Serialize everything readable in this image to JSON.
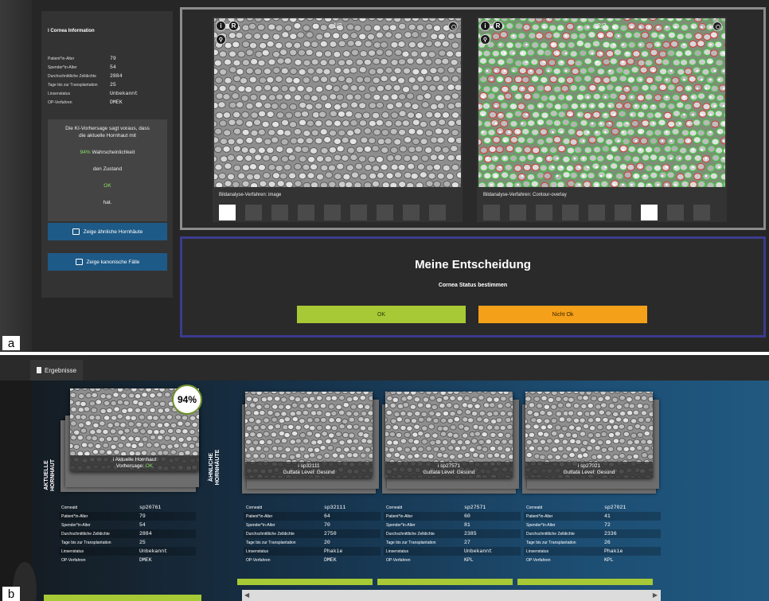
{
  "panel_a": {
    "letter": "a",
    "info_title": "i Cornea Information",
    "info_rows": [
      {
        "label": "Patient*in-Alter",
        "value": "79"
      },
      {
        "label": "Spender*in-Alter",
        "value": "54"
      },
      {
        "label": "Durchschnittliche Zelldichte",
        "value": "2884"
      },
      {
        "label": "Tage bis zur Transplantation",
        "value": "25"
      },
      {
        "label": "Linsenstatus",
        "value": "Unbekannt"
      },
      {
        "label": "OP-Verfahren",
        "value": "DMEK"
      }
    ],
    "prediction": {
      "line1": "Die KI-Vorhersage sagt voraus, dass",
      "line2": "die aktuelle Hornhaut mit",
      "percent": "94%",
      "line3": "Wahrscheinlichkeit",
      "line4": "den Zustand",
      "state": "OK",
      "line5": "hat."
    },
    "buttons": {
      "similar": "Zeige ähnliche Hornhäute",
      "canonical": "Zeige kanonische Fälle"
    },
    "viewers": [
      {
        "page": "1/2",
        "method_label": "Bildanalyse-Verfahren: image",
        "info": "i",
        "reset": "R",
        "active_thumb": 0,
        "thumb_count": 9
      },
      {
        "page": "2/2",
        "method_label": "Bildanalyse-Verfahren: Contour-overlay",
        "info": "i",
        "reset": "R",
        "active_thumb": 6,
        "thumb_count": 9
      }
    ],
    "decision": {
      "title": "Meine Entscheidung",
      "subtitle": "Cornea Status bestimmen",
      "ok": "OK",
      "not_ok": "Nicht Ok"
    }
  },
  "panel_b": {
    "letter": "b",
    "tab": "Ergebnisse",
    "current_label": "AKTUELLE HORNHAUT",
    "similar_label": "ÄHNLICHE HORNHÄUTE",
    "current": {
      "percent": "94%",
      "caption1": "i Aktuelle Hornhaut",
      "caption2_prefix": "Vorhersage:",
      "caption2_value": "OK",
      "rows": [
        {
          "label": "Corneald",
          "value": "sp20761"
        },
        {
          "label": "Patient*in-Alter",
          "value": "79"
        },
        {
          "label": "Spender*in-Alter",
          "value": "54"
        },
        {
          "label": "Durchschnittliche Zelldichte",
          "value": "2884"
        },
        {
          "label": "Tage bis zur Transplantation",
          "value": "25"
        },
        {
          "label": "Linsenstatus",
          "value": "Unbekannt"
        },
        {
          "label": "OP-Verfahren",
          "value": "DMEK"
        }
      ]
    },
    "similar": [
      {
        "caption1": "i sp32111",
        "caption2": "Guttata Level: Gesund",
        "rows": [
          {
            "label": "Corneald",
            "value": "sp32111"
          },
          {
            "label": "Patient*in-Alter",
            "value": "64"
          },
          {
            "label": "Spender*in-Alter",
            "value": "70"
          },
          {
            "label": "Durchschnittliche Zelldichte",
            "value": "2750"
          },
          {
            "label": "Tage bis zur Transplantation",
            "value": "20"
          },
          {
            "label": "Linsenstatus",
            "value": "Phakie"
          },
          {
            "label": "OP-Verfahren",
            "value": "DMEK"
          }
        ]
      },
      {
        "caption1": "i sp27571",
        "caption2": "Guttata Level: Gesund",
        "rows": [
          {
            "label": "Corneald",
            "value": "sp27571"
          },
          {
            "label": "Patient*in-Alter",
            "value": "60"
          },
          {
            "label": "Spender*in-Alter",
            "value": "81"
          },
          {
            "label": "Durchschnittliche Zelldichte",
            "value": "2385"
          },
          {
            "label": "Tage bis zur Transplantation",
            "value": "27"
          },
          {
            "label": "Linsenstatus",
            "value": "Unbekannt"
          },
          {
            "label": "OP-Verfahren",
            "value": "KPL"
          }
        ]
      },
      {
        "caption1": "i sp27021",
        "caption2": "Guttata Level: Gesund",
        "rows": [
          {
            "label": "Corneald",
            "value": "sp27021"
          },
          {
            "label": "Patient*in-Alter",
            "value": "41"
          },
          {
            "label": "Spender*in-Alter",
            "value": "72"
          },
          {
            "label": "Durchschnittliche Zelldichte",
            "value": "2336"
          },
          {
            "label": "Tage bis zur Transplantation",
            "value": "26"
          },
          {
            "label": "Linsenstatus",
            "value": "Phakie"
          },
          {
            "label": "OP-Verfahren",
            "value": "KPL"
          }
        ]
      }
    ]
  },
  "colors": {
    "accent_green": "#a6c935",
    "accent_orange": "#f4a019",
    "button_blue": "#1e5a87",
    "decision_border": "#3b3b8e",
    "prediction_green": "#8fe06b"
  }
}
